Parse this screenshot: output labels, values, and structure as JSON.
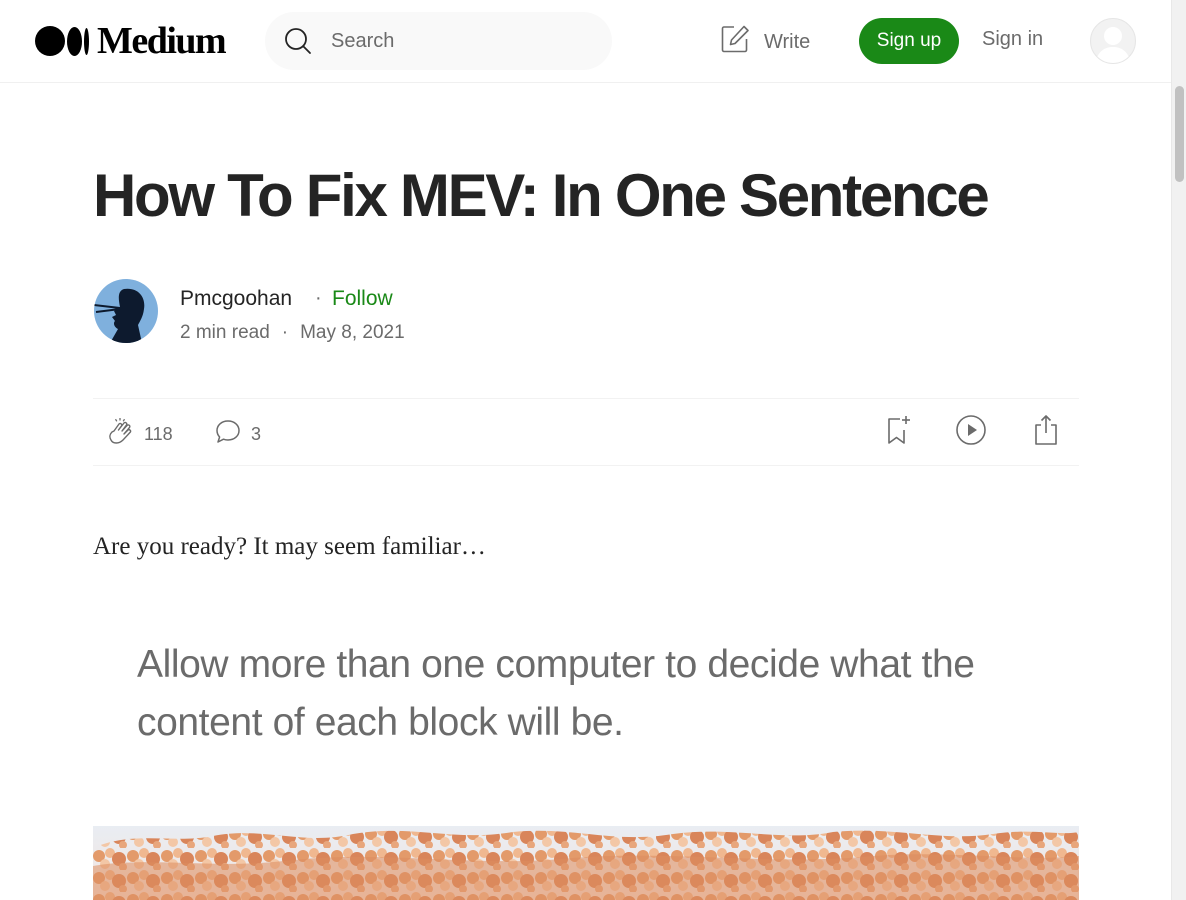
{
  "header": {
    "logo_text": "Medium",
    "search_placeholder": "Search",
    "write_label": "Write",
    "signup_label": "Sign up",
    "signin_label": "Sign in"
  },
  "article": {
    "title": "How To Fix MEV: In One Sentence",
    "author": "Pmcgoohan",
    "separator": "·",
    "follow_label": "Follow",
    "read_time": "2 min read",
    "date": "May 8, 2021",
    "claps": "118",
    "responses": "3",
    "intro": "Are you ready? It may seem familiar…",
    "pullquote": "Allow more than one computer to decide what the content of each block will be."
  },
  "icons": {
    "search": "search-icon",
    "write": "edit-icon",
    "clap": "clap-icon",
    "response": "speech-bubble-icon",
    "bookmark": "bookmark-add-icon",
    "listen": "play-icon",
    "share": "share-icon"
  },
  "colors": {
    "brand_green": "#1a8917",
    "text_primary": "#242424",
    "text_secondary": "#6b6b6b",
    "search_bg": "#f9f9f9"
  }
}
